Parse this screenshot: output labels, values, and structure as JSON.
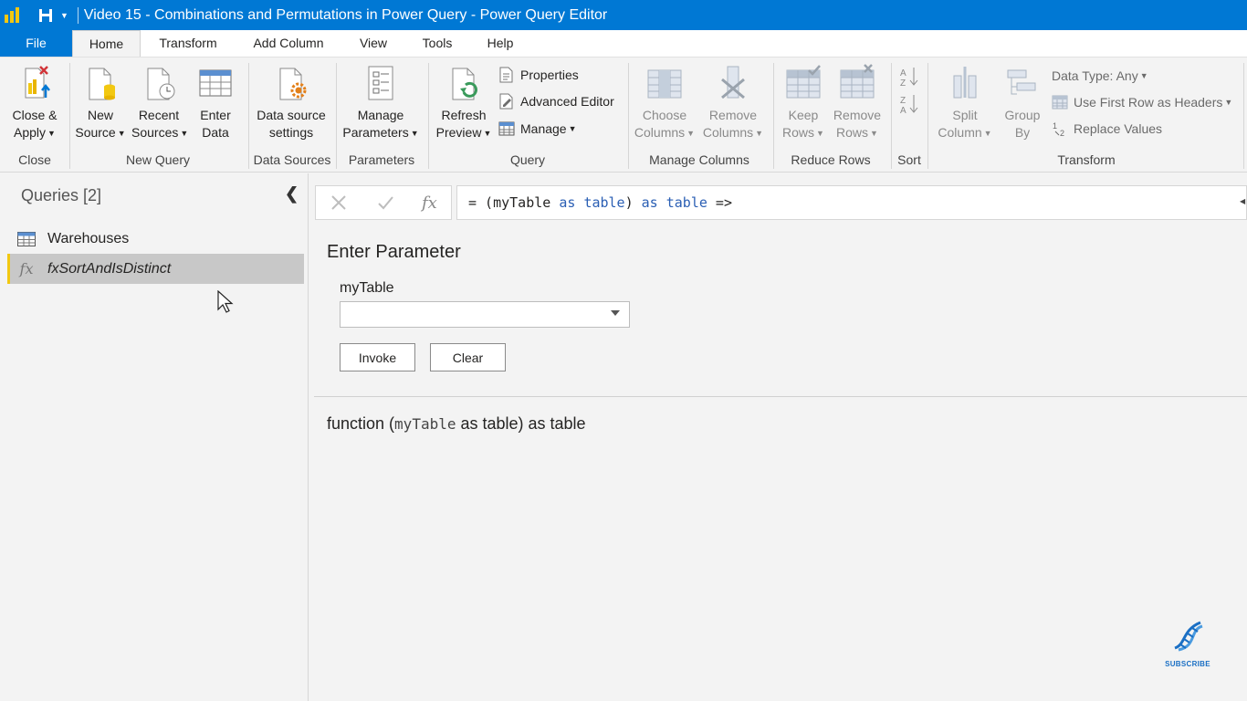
{
  "titlebar": {
    "title": "Video 15 - Combinations and Permutations in Power Query - Power Query Editor",
    "logo_icon": "power-bi-logo-icon",
    "save_icon": "save-icon",
    "customize_icon": "customize-quick-access-dropdown-icon"
  },
  "menu": {
    "file": "File",
    "tabs": [
      "Home",
      "Transform",
      "Add Column",
      "View",
      "Tools",
      "Help"
    ],
    "active_tab": "Home"
  },
  "ribbon": {
    "close_group": {
      "label": "Close",
      "close_apply": {
        "line1": "Close &",
        "line2": "Apply"
      }
    },
    "new_query_group": {
      "label": "New Query",
      "new_source": {
        "line1": "New",
        "line2": "Source"
      },
      "recent_sources": {
        "line1": "Recent",
        "line2": "Sources"
      },
      "enter_data": {
        "line1": "Enter",
        "line2": "Data"
      }
    },
    "data_sources_group": {
      "label": "Data Sources",
      "data_source_settings": {
        "line1": "Data source",
        "line2": "settings"
      }
    },
    "parameters_group": {
      "label": "Parameters",
      "manage_parameters": {
        "line1": "Manage",
        "line2": "Parameters"
      }
    },
    "query_group": {
      "label": "Query",
      "refresh_preview": {
        "line1": "Refresh",
        "line2": "Preview"
      },
      "properties": "Properties",
      "advanced_editor": "Advanced Editor",
      "manage": "Manage"
    },
    "manage_columns_group": {
      "label": "Manage Columns",
      "choose_columns": {
        "line1": "Choose",
        "line2": "Columns"
      },
      "remove_columns": {
        "line1": "Remove",
        "line2": "Columns"
      }
    },
    "reduce_rows_group": {
      "label": "Reduce Rows",
      "keep_rows": {
        "line1": "Keep",
        "line2": "Rows"
      },
      "remove_rows": {
        "line1": "Remove",
        "line2": "Rows"
      }
    },
    "sort_group": {
      "label": "Sort"
    },
    "transform_group": {
      "label": "Transform",
      "split_column": {
        "line1": "Split",
        "line2": "Column"
      },
      "group_by": {
        "line1": "Group",
        "line2": "By"
      },
      "data_type": "Data Type: Any",
      "use_first_row": "Use First Row as Headers",
      "replace_values": "Replace Values"
    }
  },
  "queries": {
    "header": "Queries [2]",
    "items": [
      {
        "label": "Warehouses",
        "icon": "table-icon",
        "selected": false
      },
      {
        "label": "fxSortAndIsDistinct",
        "icon": "function-icon",
        "selected": true
      }
    ]
  },
  "formula_bar": {
    "cancel_icon": "cancel-x-icon",
    "commit_icon": "checkmark-icon",
    "fx_label": "fx",
    "p1": "= (myTable ",
    "k1": "as",
    "s1": " ",
    "k2": "table",
    "p2": ") ",
    "k3": "as",
    "s2": " ",
    "k4": "table",
    "p3": " =>"
  },
  "parameter_panel": {
    "title": "Enter Parameter",
    "param_label": "myTable",
    "param_value": "",
    "invoke_label": "Invoke",
    "clear_label": "Clear",
    "signature_pre": "function (",
    "signature_mono": "myTable",
    "signature_post": " as table) as table"
  },
  "overlay": {
    "subscribe_text": "SUBSCRIBE",
    "subscribe_icon": "dna-helix-icon"
  },
  "colors": {
    "accent": "#0078d4",
    "logo_yellow": "#f2c811",
    "keyword_blue": "#2b5fb4"
  }
}
